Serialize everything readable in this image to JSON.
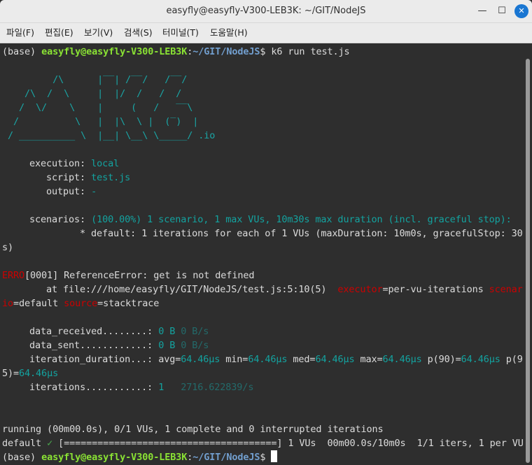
{
  "window": {
    "title": "easyfly@easyfly-V300-LEB3K: ~/GIT/NodeJS",
    "minimize": "—",
    "maximize": "☐",
    "close": "✕"
  },
  "menu": [
    "파일(F)",
    "편집(E)",
    "보기(V)",
    "검색(S)",
    "터미널(T)",
    "도움말(H)"
  ],
  "prompt": {
    "env": "(base) ",
    "user_host": "easyfly@easyfly-V300-LEB3K",
    "colon": ":",
    "path": "~/GIT/NodeJS",
    "dollar": "$ ",
    "command": "k6 run test.js"
  },
  "logo": [
    "         /\\      |‾‾| /‾‾/   /‾‾/",
    "    /\\  /  \\     |  |/  /   /  /",
    "   /  \\/    \\    |     (   /   ‾‾\\",
    "  /          \\   |  |\\  \\ |  (‾)  |",
    " / __________ \\  |__| \\__\\ \\_____/ .io"
  ],
  "execution": {
    "label": "execution: ",
    "value": "local"
  },
  "script": {
    "label": "script: ",
    "value": "test.js"
  },
  "output": {
    "label": "output: ",
    "value": "-"
  },
  "scenarios": {
    "label": "scenarios: ",
    "value": "(100.00%) 1 scenario, 1 max VUs, 10m30s max duration (incl. graceful stop):",
    "detail_1": "* default: 1 iterations for each of 1 VUs (maxDuration: 10m0s, gracefulStop: 30",
    "detail_2": "s)"
  },
  "error": {
    "level": "ERRO",
    "message": "[0001] ReferenceError: get is not defined",
    "at": "at file:///home/easyfly/GIT/NodeJS/test.js:5:10(5)",
    "executor_key": "executor",
    "executor_value": "=per-vu-iterations ",
    "scenario_key_1": "scenar",
    "scenario_key_2": "io",
    "scenario_value": "=default ",
    "source_key": "source",
    "source_value": "=stacktrace"
  },
  "metrics": {
    "data_received": {
      "label": "data_received........: ",
      "value": "0 B",
      "rate": " 0 B/s"
    },
    "data_sent": {
      "label": "data_sent............: ",
      "value": "0 B",
      "rate": " 0 B/s"
    },
    "iteration_duration": {
      "label": "iteration_duration...: ",
      "avg_key": "avg=",
      "avg": "64.46µs",
      "min_key": " min=",
      "min": "64.46µs",
      "med_key": " med=",
      "med": "64.46µs",
      "max_key": " max=",
      "max": "64.46µs",
      "p90_key": " p(90)=",
      "p90": "64.46µs",
      "p95_key_1": " p(9",
      "p95_key_2": "5)=",
      "p95": "64.46µs"
    },
    "iterations": {
      "label": "iterations...........: ",
      "value": "1",
      "rate": "   2716.622839/s"
    }
  },
  "status": {
    "running": "running (00m00.0s), 0/1 VUs, 1 complete and 0 interrupted iterations",
    "default": "default ",
    "check": "✓",
    "progress": " [======================================] 1 VUs  00m00.0s/10m0s  1/1 iters, 1 per VU"
  }
}
